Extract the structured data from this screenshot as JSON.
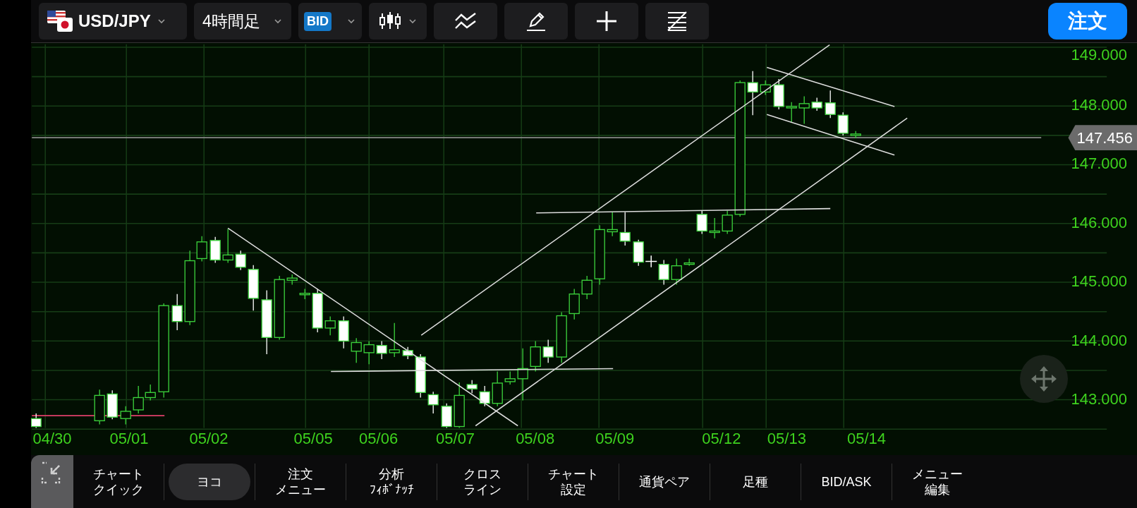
{
  "toolbar": {
    "pair": "USD/JPY",
    "timeframe": "4時間足",
    "price_type": "BID",
    "order_button": "注文"
  },
  "chart": {
    "y_labels": [
      "149.000",
      "148.000",
      "147.000",
      "146.000",
      "145.000",
      "144.000",
      "143.000"
    ],
    "current_price": "147.456",
    "x_labels": [
      "04/30",
      "05/01",
      "05/02",
      "05/05",
      "05/06",
      "05/07",
      "05/08",
      "05/09",
      "05/12",
      "05/13",
      "05/14"
    ]
  },
  "bottom_menu": [
    {
      "lines": [
        "チャート",
        "クイック"
      ],
      "selected": false
    },
    {
      "lines": [
        "ヨコ"
      ],
      "selected": true
    },
    {
      "lines": [
        "注文",
        "メニュー"
      ],
      "selected": false
    },
    {
      "lines": [
        "分析",
        "ﾌｨﾎﾞﾅｯﾁ"
      ],
      "selected": false
    },
    {
      "lines": [
        "クロス",
        "ライン"
      ],
      "selected": false
    },
    {
      "lines": [
        "チャート",
        "設定"
      ],
      "selected": false
    },
    {
      "lines": [
        "通貨ペア"
      ],
      "selected": false
    },
    {
      "lines": [
        "足種"
      ],
      "selected": false
    },
    {
      "lines": [
        "BID/ASK"
      ],
      "selected": false
    },
    {
      "lines": [
        "メニュー",
        "編集"
      ],
      "selected": false
    }
  ]
}
